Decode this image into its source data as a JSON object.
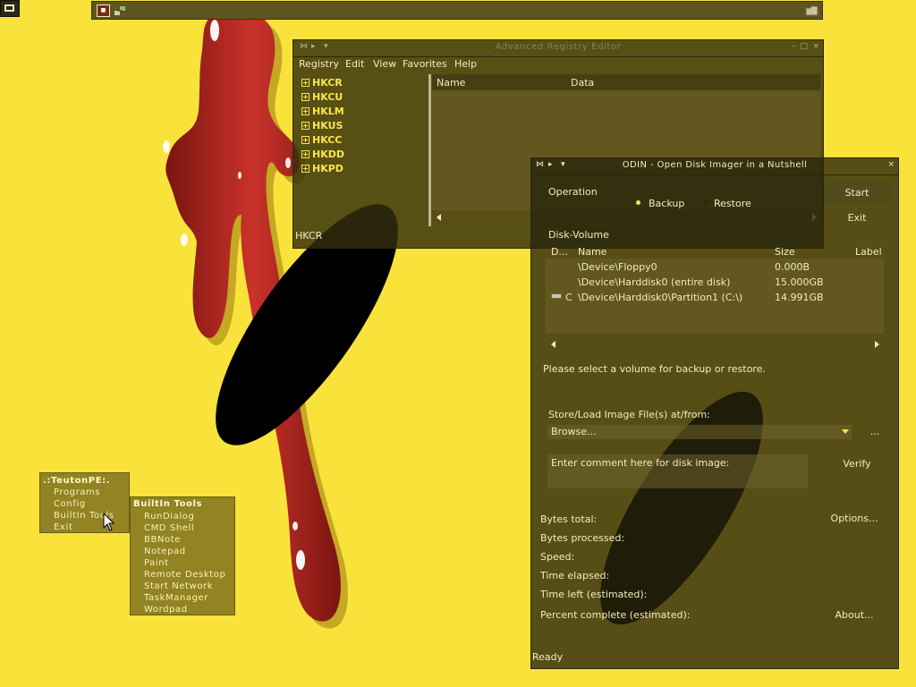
{
  "taskbar": {
    "icons": [
      "odin-app-icon",
      "network-icon"
    ],
    "tray_icon": "folder-tray-icon"
  },
  "registry_window": {
    "title": "Advanced Registry Editor",
    "menu": [
      "Registry",
      "Edit",
      "View",
      "Favorites",
      "Help"
    ],
    "tree": [
      "HKCR",
      "HKCU",
      "HKLM",
      "HKUS",
      "HKCC",
      "HKDD",
      "HKPD"
    ],
    "columns": {
      "name": "Name",
      "data": "Data"
    },
    "status": "HKCR"
  },
  "odin_window": {
    "title": "ODIN - Open Disk Imager in a Nutshell",
    "operation_label": "Operation",
    "backup_label": "Backup",
    "restore_label": "Restore",
    "selected_operation": "Backup",
    "start_button": "Start",
    "exit_button": "Exit",
    "disk_volume_label": "Disk-Volume",
    "columns": {
      "drive": "D...",
      "name": "Name",
      "size": "Size",
      "label": "Label"
    },
    "volumes": [
      {
        "drive": "",
        "name": "\\Device\\Floppy0",
        "size": "0.000B",
        "label": ""
      },
      {
        "drive": "",
        "name": "\\Device\\Harddisk0 (entire disk)",
        "size": "15.000GB",
        "label": ""
      },
      {
        "drive": "C",
        "name": "\\Device\\Harddisk0\\Partition1 (C:\\)",
        "size": "14.991GB",
        "label": ""
      }
    ],
    "prompt": "Please select a volume for backup or restore.",
    "store_label": "Store/Load Image File(s) at/from:",
    "browse_value": "Browse...",
    "dots_button": "...",
    "comment_placeholder": "Enter comment here for disk image:",
    "verify_button": "Verify",
    "options_button": "Options...",
    "about_button": "About...",
    "stats": [
      "Bytes total:",
      "Bytes processed:",
      "Speed:",
      "Time elapsed:",
      "Time left (estimated):",
      "Percent complete (estimated):"
    ],
    "status": "Ready"
  },
  "start_menu": {
    "header": ".:TeutonPE:.",
    "items": [
      "Programs",
      "Config",
      "BuiltIn Tools",
      "Exit"
    ]
  },
  "submenu": {
    "header": "BuiltIn Tools",
    "items": [
      "RunDialog",
      "CMD Shell",
      "BBNote",
      "Notepad",
      "Paint",
      "Remote Desktop",
      "Start Network",
      "TaskManager",
      "Wordpad"
    ]
  },
  "colors": {
    "wallpaper": "#f9e33b",
    "window_bg": "#342e0e",
    "menu_bg": "#786a1e",
    "accent": "#f8e64a",
    "drip": "#b5281f"
  }
}
